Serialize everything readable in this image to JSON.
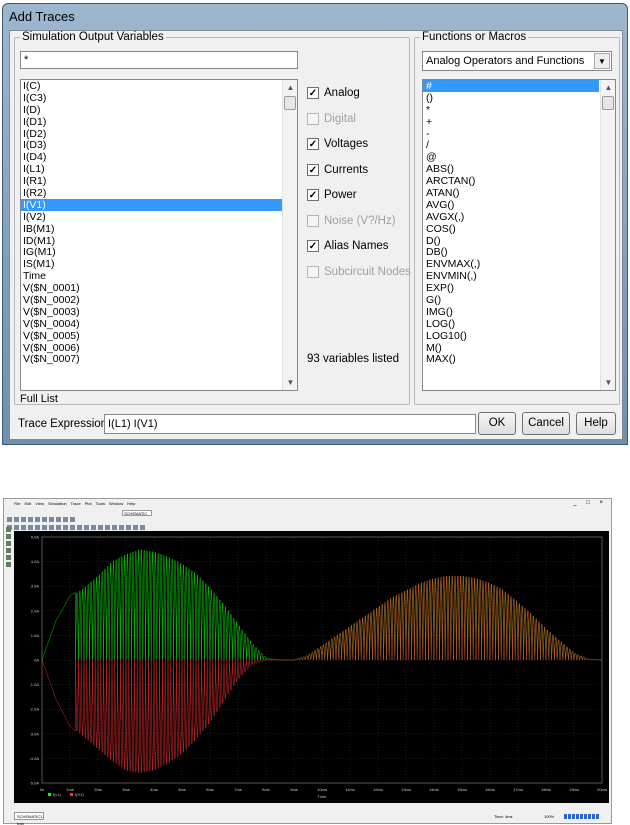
{
  "dialog": {
    "title": "Add Traces",
    "sov_label": "Simulation Output Variables",
    "filter_value": "*",
    "variables": [
      "I(C)",
      "I(C3)",
      "I(D)",
      "I(D1)",
      "I(D2)",
      "I(D3)",
      "I(D4)",
      "I(L1)",
      "I(R1)",
      "I(R2)",
      "I(V1)",
      "I(V2)",
      "IB(M1)",
      "ID(M1)",
      "IG(M1)",
      "IS(M1)",
      "Time",
      "V($N_0001)",
      "V($N_0002)",
      "V($N_0003)",
      "V($N_0004)",
      "V($N_0005)",
      "V($N_0006)",
      "V($N_0007)"
    ],
    "selected_variable": "I(V1)",
    "checkboxes": {
      "analog": {
        "label": "Analog",
        "checked": true,
        "enabled": true
      },
      "digital": {
        "label": "Digital",
        "checked": false,
        "enabled": false
      },
      "voltages": {
        "label": "Voltages",
        "checked": true,
        "enabled": true
      },
      "currents": {
        "label": "Currents",
        "checked": true,
        "enabled": true
      },
      "power": {
        "label": "Power",
        "checked": true,
        "enabled": true
      },
      "noise": {
        "label": "Noise (V?/Hz)",
        "checked": false,
        "enabled": false
      },
      "alias": {
        "label": "Alias Names",
        "checked": true,
        "enabled": true
      },
      "subckt": {
        "label": "Subcircuit Nodes",
        "checked": false,
        "enabled": false
      }
    },
    "count_text": "93 variables listed",
    "full_list": "Full List",
    "fom_label": "Functions or Macros",
    "fom_select": "Analog Operators and Functions",
    "functions": [
      "#",
      "()",
      "*",
      "+",
      "-",
      "/",
      "@",
      "ABS()",
      "ARCTAN()",
      "ATAN()",
      "AVG()",
      "AVGX(,)",
      "COS()",
      "D()",
      "DB()",
      "ENVMAX(,)",
      "ENVMIN(,)",
      "EXP()",
      "G()",
      "IMG()",
      "LOG()",
      "LOG10()",
      "M()",
      "MAX()"
    ],
    "trace_label": "Trace Expression:",
    "trace_value": "I(L1) I(V1)",
    "ok": "OK",
    "cancel": "Cancel",
    "help": "Help"
  },
  "pspice": {
    "menus": [
      "File",
      "Edit",
      "View",
      "Simulation",
      "Trace",
      "Plot",
      "Tools",
      "Window",
      "Help"
    ],
    "combo": "SCHEMATIC",
    "window_controls": "_ □ ×",
    "tab": "SCHEMATIC1-tran",
    "status": "Time: 4ms",
    "zoom": "100%"
  },
  "chart_data": {
    "type": "line",
    "xlabel": "Time",
    "ylabel": "",
    "xlim": [
      0,
      20
    ],
    "ylim": [
      -5,
      5
    ],
    "x_ticks": [
      "0s",
      "1ms",
      "2ms",
      "3ms",
      "4ms",
      "5ms",
      "6ms",
      "7ms",
      "8ms",
      "9ms",
      "10ms",
      "11ms",
      "12ms",
      "13ms",
      "14ms",
      "15ms",
      "16ms",
      "17ms",
      "18ms",
      "19ms",
      "20ms"
    ],
    "y_ticks": [
      "5.0A",
      "4.0A",
      "3.0A",
      "2.0A",
      "1.0A",
      "0A",
      "-1.0A",
      "-2.0A",
      "-3.0A",
      "-4.0A",
      "-5.0A"
    ],
    "legend": [
      "I(L1)",
      "I(V1)"
    ],
    "series": [
      {
        "name": "I(L1)",
        "color": "#00ff00",
        "x": [
          0,
          0.5,
          1,
          1.5,
          2,
          2.5,
          3,
          3.5,
          4,
          4.5,
          5,
          5.5,
          6,
          6.5,
          7,
          7.5,
          8,
          8.5,
          9,
          9.5,
          10,
          10.5,
          11,
          11.5,
          12,
          12.5,
          13,
          13.5,
          14,
          14.5,
          15,
          15.5,
          16,
          16.5,
          17,
          17.5,
          18,
          18.5,
          19,
          19.5,
          20
        ],
        "values": [
          0,
          1.6,
          2.6,
          3.0,
          3.5,
          4.1,
          4.4,
          4.6,
          4.5,
          4.3,
          4.0,
          3.6,
          3.0,
          2.3,
          1.5,
          0.7,
          0.1,
          0,
          0,
          0.2,
          0.6,
          1.0,
          1.4,
          1.8,
          2.2,
          2.6,
          2.9,
          3.2,
          3.4,
          3.5,
          3.5,
          3.4,
          3.2,
          2.9,
          2.4,
          1.9,
          1.3,
          0.8,
          0.3,
          0.05,
          0
        ]
      },
      {
        "name": "I(V1)",
        "color": "#ff3030",
        "x": [
          0,
          0.5,
          1,
          1.5,
          2,
          2.5,
          3,
          3.5,
          4,
          4.5,
          5,
          5.5,
          6,
          6.5,
          7,
          7.5,
          8,
          8.5,
          9,
          9.5,
          10,
          10.5,
          11,
          11.5,
          12,
          12.5,
          13,
          13.5,
          14,
          14.5,
          15,
          15.5,
          16,
          16.5,
          17,
          17.5,
          18,
          18.5,
          19,
          19.5,
          20
        ],
        "values": [
          0,
          -1.6,
          -2.7,
          -3.2,
          -3.7,
          -4.2,
          -4.6,
          -4.7,
          -4.6,
          -4.3,
          -3.9,
          -3.3,
          -2.6,
          -1.7,
          -0.8,
          -0.2,
          0,
          0,
          0,
          0.2,
          0.6,
          1.0,
          1.4,
          1.8,
          2.2,
          2.6,
          2.9,
          3.2,
          3.4,
          3.5,
          3.5,
          3.4,
          3.2,
          2.9,
          2.4,
          1.9,
          1.3,
          0.8,
          0.3,
          0.05,
          0
        ]
      }
    ]
  }
}
